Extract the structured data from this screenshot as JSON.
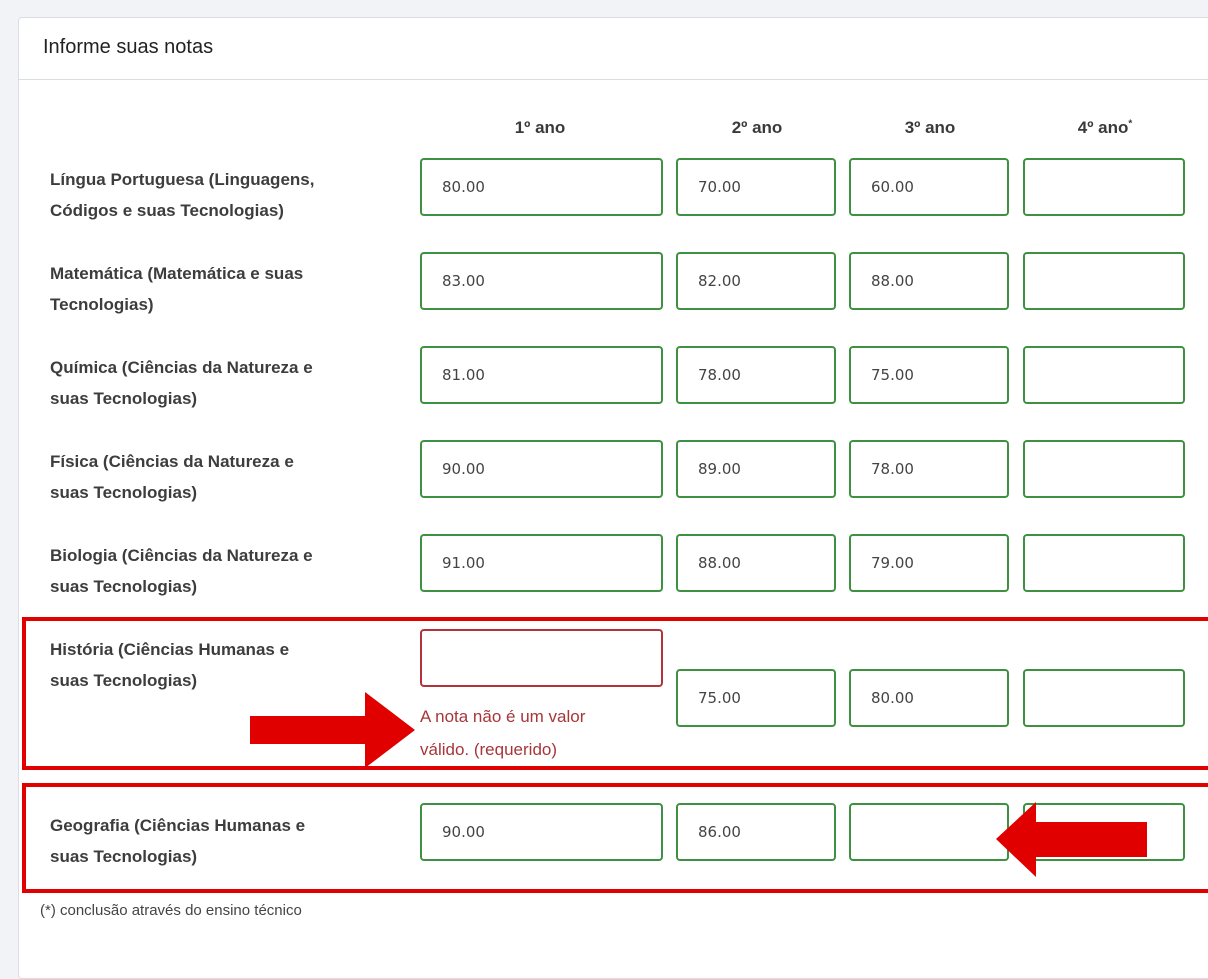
{
  "panel": {
    "title": "Informe suas notas"
  },
  "columns": [
    "1º ano",
    "2º ano",
    "3º ano",
    "4º ano"
  ],
  "column_marker": "*",
  "rows": [
    {
      "subject_line1": "Língua Portuguesa (Linguagens,",
      "subject_line2": "Códigos e suas Tecnologias)",
      "grades": [
        "80.00",
        "70.00",
        "60.00",
        ""
      ]
    },
    {
      "subject_line1": "Matemática (Matemática e suas",
      "subject_line2": "Tecnologias)",
      "grades": [
        "83.00",
        "82.00",
        "88.00",
        ""
      ]
    },
    {
      "subject_line1": "Química (Ciências da Natureza e",
      "subject_line2": "suas Tecnologias)",
      "grades": [
        "81.00",
        "78.00",
        "75.00",
        ""
      ]
    },
    {
      "subject_line1": "Física (Ciências da Natureza e",
      "subject_line2": "suas Tecnologias)",
      "grades": [
        "90.00",
        "89.00",
        "78.00",
        ""
      ]
    },
    {
      "subject_line1": "Biologia (Ciências da Natureza e",
      "subject_line2": "suas Tecnologias)",
      "grades": [
        "91.00",
        "88.00",
        "79.00",
        ""
      ]
    },
    {
      "subject_line1": "História (Ciências Humanas e",
      "subject_line2": "suas Tecnologias)",
      "grades": [
        "",
        "75.00",
        "80.00",
        ""
      ]
    },
    {
      "subject_line1": "Geografia (Ciências Humanas e",
      "subject_line2": "suas Tecnologias)",
      "grades": [
        "90.00",
        "86.00",
        "",
        ""
      ]
    }
  ],
  "validation": {
    "line1": "A nota não é um valor",
    "line2": "válido. (requerido)"
  },
  "footnote": "(*) conclusão através do ensino técnico",
  "colors": {
    "valid_border": "#3f9142",
    "error_border": "#b2343a",
    "error_text": "#a7363a",
    "annotation": "#e00000"
  }
}
